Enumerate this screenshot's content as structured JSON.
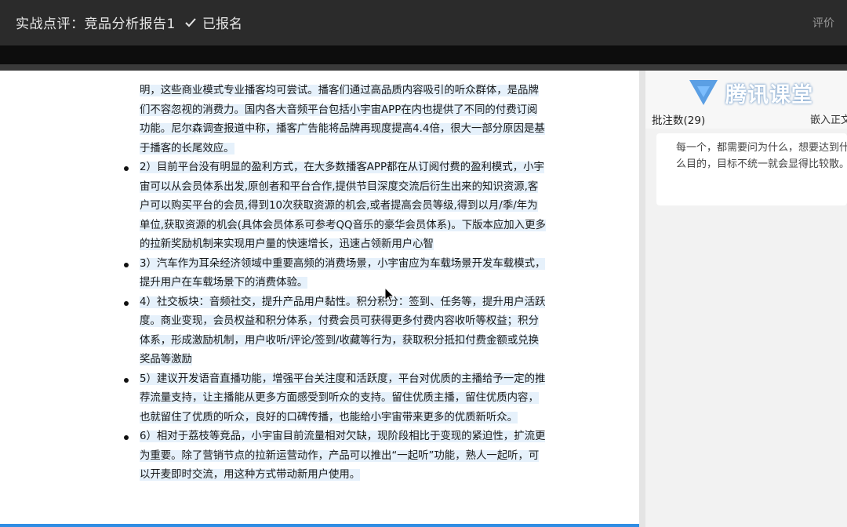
{
  "header": {
    "title": "实战点评：竞品分析报告1",
    "status": "已报名",
    "rate": "评价"
  },
  "document": {
    "continuation": "明，这些商业模式专业播客均可尝试。播客们通过高品质内容吸引的听众群体，是品牌们不容忽视的消费力。国内各大音频平台包括小宇宙APP在内也提供了不同的付费订阅功能。尼尔森调查报道中称，播客广告能将品牌再现度提高4.4倍，很大一部分原因是基于播客的长尾效应。",
    "items": [
      "2）目前平台没有明显的盈利方式，在大多数播客APP都在从订阅付费的盈利模式，小宇宙可以从会员体系出发,原创者和平台合作,提供节目深度交流后衍生出来的知识资源,客户可以购买平台的会员,得到10次获取资源的机会,或者提高会员等级,得到以月/季/年为单位,获取资源的机会(具体会员体系可参考QQ音乐的豪华会员体系)。下版本应加入更多的拉新奖励机制来实现用户量的快速增长，迅速占领新用户心智",
      "3）汽车作为耳朵经济领域中重要高频的消费场景，小宇宙应为车载场景开发车载模式，提升用户在车载场景下的消费体验。",
      "4）社交板块：音频社交，提升产品用户黏性。积分积分：签到、任务等，提升用户活跃度。商业变现，会员权益和积分体系，付费会员可获得更多付费内容收听等权益；积分体系，形成激励机制，用户收听/评论/签到/收藏等行为，获取积分抵扣付费金额或兑换奖品等激励",
      "5）建议开发语音直播功能，增强平台关注度和活跃度，平台对优质的主播给予一定的推荐流量支持，让主播能从更多方面感受到听众的支持。留住优质主播，留住优质内容，也就留住了优质的听众，良好的口碑传播，也能给小宇宙带来更多的优质新听众。",
      "6）相对于荔枝等竞品，小宇宙目前流量相对欠缺，现阶段相比于变现的紧迫性，扩流更为重要。除了营销节点的拉新运营动作，产品可以推出“一起听”功能，熟人一起听，可以开麦即时交流，用这种方式带动新用户使用。"
    ]
  },
  "sidebar": {
    "logo_text": "腾讯课堂",
    "comment_count": "批注数(29)",
    "embed_label": "嵌入正文",
    "comment_text": "每一个，都需要问为什么，想要达到什么目的，目标不统一就会显得比较散。"
  },
  "colors": {
    "highlight": "#e6f1fb",
    "accent": "#2f8de4",
    "logo_blue": "#3f8fe0"
  }
}
